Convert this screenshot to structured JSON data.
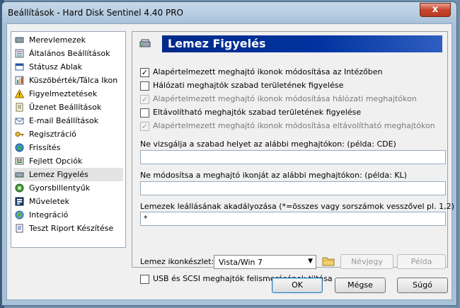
{
  "window": {
    "title": "Beállítások  -  Hard Disk Sentinel 4.40 PRO",
    "close_label": "x"
  },
  "sidebar": {
    "selected": "Lemez Figyelés",
    "items": [
      {
        "label": "Merevlemezek",
        "icon": "hard-disk-icon"
      },
      {
        "label": "Általános Beállítások",
        "icon": "settings-icon"
      },
      {
        "label": "Státusz Ablak",
        "icon": "window-icon"
      },
      {
        "label": "Küszöbérték/Tálca Ikon",
        "icon": "threshold-icon"
      },
      {
        "label": "Figyelmeztetések",
        "icon": "warning-icon"
      },
      {
        "label": "Üzenet Beállítások",
        "icon": "message-icon"
      },
      {
        "label": "E-mail Beállítások",
        "icon": "email-icon"
      },
      {
        "label": "Regisztráció",
        "icon": "key-icon"
      },
      {
        "label": "Frissítés",
        "icon": "globe-icon"
      },
      {
        "label": "Fejlett Opciók",
        "icon": "advanced-icon"
      },
      {
        "label": "Lemez Figyelés",
        "icon": "disk-monitor-icon"
      },
      {
        "label": "Gyorsbillentyűk",
        "icon": "hotkey-icon"
      },
      {
        "label": "Műveletek",
        "icon": "actions-icon"
      },
      {
        "label": "Integráció",
        "icon": "integration-icon"
      },
      {
        "label": "Teszt Riport Készítése",
        "icon": "report-icon"
      }
    ]
  },
  "panel": {
    "title": "Lemez Figyelés",
    "checkboxes": [
      {
        "label": "Alapértelmezett meghajtó ikonok módosítása az Intézőben",
        "checked": true,
        "enabled": true
      },
      {
        "label": "Hálózati meghajtók szabad területének figyelése",
        "checked": false,
        "enabled": true
      },
      {
        "label": "Alapértelmezett meghajtó ikonok módosítása hálózati meghajtókon",
        "checked": true,
        "enabled": false
      },
      {
        "label": "Eltávolítható meghajtók szabad területének figyelése",
        "checked": false,
        "enabled": true
      },
      {
        "label": "Alapértelmezett meghajtó ikonok módosítása eltávolítható meghajtókon",
        "checked": true,
        "enabled": false
      }
    ],
    "fields": [
      {
        "label": "Ne vizsgálja a szabad helyet az alábbi meghajtókon: (példa: CDE)",
        "value": ""
      },
      {
        "label": "Ne módosítsa a meghajtó ikonját az alábbi meghajtókon: (példa: KL)",
        "value": ""
      },
      {
        "label": "Lemezek leállásának akadályozása (*=összes vagy sorszámok vesszővel pl. 1,2)",
        "value": "*"
      }
    ],
    "iconset_label": "Lemez ikonkészlet:",
    "iconset_value": "Vista/Win 7",
    "iconset_arrow": "▼",
    "nevjegy_label": "Névjegy",
    "pelda_label": "Példa",
    "usb_label": "USB és SCSI meghajtók felismerésének tiltása",
    "usb_checked": false
  },
  "buttons": {
    "ok": "OK",
    "cancel": "Mégse",
    "help": "Súgó"
  }
}
